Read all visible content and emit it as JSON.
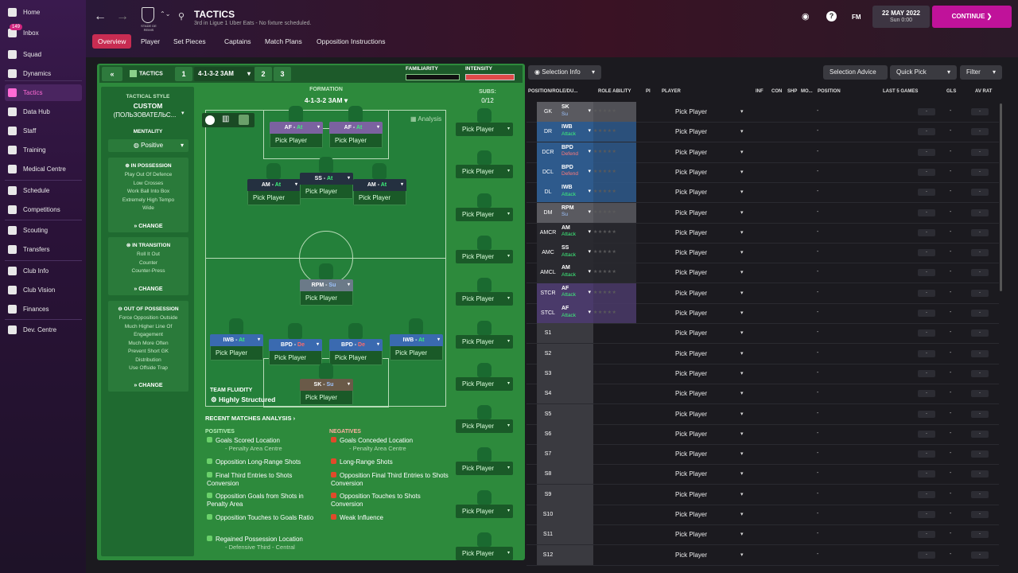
{
  "sidebar": {
    "items": [
      "Home",
      "Inbox",
      "Squad",
      "Dynamics",
      "Tactics",
      "Data Hub",
      "Staff",
      "Training",
      "Medical Centre",
      "Schedule",
      "Competitions",
      "Scouting",
      "Transfers",
      "Club Info",
      "Club Vision",
      "Finances",
      "Dev. Centre"
    ],
    "inbox_badge": "149"
  },
  "header": {
    "title": "TACTICS",
    "subtitle": "3rd in Ligue 1 Uber Eats - No fixture scheduled.",
    "club_name": "STADE DE REIMS",
    "fm_label": "FM",
    "date": "22 MAY 2022",
    "time": "Sun 0:00",
    "continue_label": "CONTINUE"
  },
  "tabs": [
    "Overview",
    "Player",
    "Set Pieces",
    "Captains",
    "Match Plans",
    "Opposition Instructions"
  ],
  "tactics_header": {
    "collapse": "«",
    "label": "TACTICS",
    "slots": [
      "1",
      "2",
      "3"
    ],
    "active_tactic": "4-1-3-2 3AM",
    "familiarity_label": "FAMILIARITY",
    "intensity_label": "INTENSITY"
  },
  "left_col": {
    "style_label": "TACTICAL STYLE",
    "style_value": "CUSTOM",
    "style_name": "(ПОЛЬЗОВАТЕЛЬС...",
    "mentality_label": "MENTALITY",
    "mentality_value": "Positive",
    "in_possession": {
      "title": "IN POSSESSION",
      "items": [
        "Play Out Of Defence",
        "Low Crosses",
        "Work Ball Into Box",
        "Extremely High Tempo",
        "Wide"
      ]
    },
    "in_transition": {
      "title": "IN TRANSITION",
      "items": [
        "Roll It Out",
        "Counter",
        "Counter-Press"
      ]
    },
    "out_of_possession": {
      "title": "OUT OF POSSESSION",
      "items": [
        "Force Opposition Outside",
        "Much Higher Line Of",
        "Engagement",
        "Much More Often",
        "Prevent Short GK",
        "Distribution",
        "Use Offside Trap"
      ]
    },
    "change_label": "CHANGE"
  },
  "formation": {
    "label": "FORMATION",
    "value": "4-1-3-2 3AM",
    "subs_label": "SUBS:",
    "subs_value": "0/12",
    "analysis_label": "Analysis",
    "team_fluidity_label": "TEAM FLUIDITY",
    "team_fluidity_value": "Highly Structured"
  },
  "pitch_roles": [
    {
      "code": "AF",
      "duty": "At"
    },
    {
      "code": "AF",
      "duty": "At"
    },
    {
      "code": "AM",
      "duty": "At"
    },
    {
      "code": "SS",
      "duty": "At"
    },
    {
      "code": "AM",
      "duty": "At"
    },
    {
      "code": "RPM",
      "duty": "Su"
    },
    {
      "code": "IWB",
      "duty": "At"
    },
    {
      "code": "BPD",
      "duty": "De"
    },
    {
      "code": "BPD",
      "duty": "De"
    },
    {
      "code": "IWB",
      "duty": "At"
    },
    {
      "code": "SK",
      "duty": "Su"
    }
  ],
  "pick_player": "Pick Player",
  "analysis": {
    "title": "RECENT MATCHES ANALYSIS",
    "positives_label": "POSITIVES",
    "negatives_label": "NEGATIVES",
    "positives": [
      {
        "t": "Goals Scored Location",
        "s": "- Penalty Area Centre"
      },
      {
        "t": "Opposition Long-Range Shots"
      },
      {
        "t": "Final Third Entries to Shots Conversion"
      },
      {
        "t": "Opposition Goals from Shots in Penalty Area"
      },
      {
        "t": "Opposition Touches to Goals Ratio"
      },
      {
        "t": "Regained Possession Location",
        "s": "- Defensive Third - Central"
      }
    ],
    "negatives": [
      {
        "t": "Goals Conceded Location",
        "s": "- Penalty Area Centre"
      },
      {
        "t": "Long-Range Shots"
      },
      {
        "t": "Opposition Final Third Entries to Shots Conversion"
      },
      {
        "t": "Opposition Touches to Shots Conversion"
      },
      {
        "t": "Weak Influence"
      }
    ]
  },
  "right_panel": {
    "selection_info": "Selection Info",
    "selection_advice": "Selection Advice",
    "quick_pick": "Quick Pick",
    "filter": "Filter",
    "columns": [
      "POSITION/ROLE/DU...",
      "ROLE ABILITY",
      "PI",
      "PLAYER",
      "INF",
      "CON",
      "SHP",
      "MO...",
      "POSITION",
      "LAST 5 GAMES",
      "GLS",
      "AV RAT"
    ],
    "rows": [
      {
        "pos": "GK",
        "role": "SK",
        "duty": "Su",
        "color": "#5a5a60"
      },
      {
        "pos": "DR",
        "role": "IWB",
        "duty": "Attack",
        "color": "#2e5a8c"
      },
      {
        "pos": "DCR",
        "role": "BPD",
        "duty": "Defend",
        "color": "#2e5a8c"
      },
      {
        "pos": "DCL",
        "role": "BPD",
        "duty": "Defend",
        "color": "#2e5a8c"
      },
      {
        "pos": "DL",
        "role": "IWB",
        "duty": "Attack",
        "color": "#2e5a8c"
      },
      {
        "pos": "DM",
        "role": "RPM",
        "duty": "Su",
        "color": "#5a5a60"
      },
      {
        "pos": "AMCR",
        "role": "AM",
        "duty": "Attack",
        "color": "#2a2a30"
      },
      {
        "pos": "AMC",
        "role": "SS",
        "duty": "Attack",
        "color": "#2a2a30"
      },
      {
        "pos": "AMCL",
        "role": "AM",
        "duty": "Attack",
        "color": "#2a2a30"
      },
      {
        "pos": "STCR",
        "role": "AF",
        "duty": "Attack",
        "color": "#4a3a6a"
      },
      {
        "pos": "STCL",
        "role": "AF",
        "duty": "Attack",
        "color": "#4a3a6a"
      },
      {
        "pos": "S1"
      },
      {
        "pos": "S2"
      },
      {
        "pos": "S3"
      },
      {
        "pos": "S4"
      },
      {
        "pos": "S5"
      },
      {
        "pos": "S6"
      },
      {
        "pos": "S7"
      },
      {
        "pos": "S8"
      },
      {
        "pos": "S9"
      },
      {
        "pos": "S10"
      },
      {
        "pos": "S11"
      },
      {
        "pos": "S12"
      }
    ]
  }
}
